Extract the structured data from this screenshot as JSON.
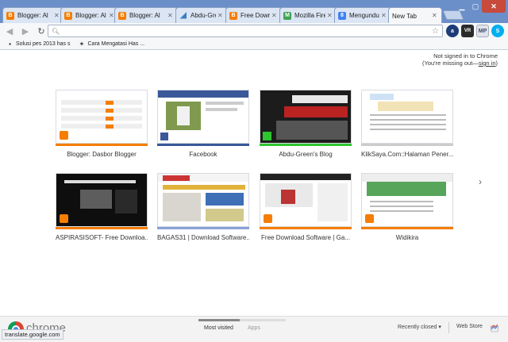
{
  "tabs": [
    {
      "title": "Blogger: Al",
      "icon": "blogger-icon",
      "active": false
    },
    {
      "title": "Blogger: Al",
      "icon": "blogger-icon",
      "active": false
    },
    {
      "title": "Blogger: Al",
      "icon": "blogger-icon",
      "active": false
    },
    {
      "title": "Abdu-Green",
      "icon": "abdu-green-icon",
      "active": false
    },
    {
      "title": "Free Downl",
      "icon": "blogger-icon",
      "active": false
    },
    {
      "title": "Mozilla Fire",
      "icon": "mozilla-icon",
      "active": false
    },
    {
      "title": "Mengunduh",
      "icon": "google-icon",
      "active": false
    },
    {
      "title": "New Tab",
      "icon": "",
      "active": true
    }
  ],
  "toolbar": {
    "back_icon": "back-arrow-icon",
    "forward_icon": "forward-arrow-icon",
    "reload_icon": "reload-icon",
    "omnibox_value": "",
    "extensions": [
      {
        "name": "a-extension-icon",
        "glyph": "a"
      },
      {
        "name": "vr-extension-icon",
        "glyph": "VR"
      },
      {
        "name": "mp-extension-icon",
        "glyph": "MP"
      },
      {
        "name": "skype-icon",
        "glyph": "S"
      },
      {
        "name": "menu-icon",
        "glyph": "≡"
      }
    ]
  },
  "bookmarks": [
    {
      "label": "Solusi pes 2013 has s",
      "icon": "pes-icon"
    },
    {
      "label": "Cara Mengatasi Has ...",
      "icon": "bug-icon"
    }
  ],
  "signin": {
    "line1": "Not signed in to Chrome",
    "line2_prefix": "(You're missing out—",
    "line2_link": "sign in",
    "line2_suffix": ")"
  },
  "most_visited": [
    {
      "label": "Blogger: Dasbor Blogger",
      "bar_color": "#f57d00",
      "kind": "blogger"
    },
    {
      "label": "Facebook",
      "bar_color": "#3b5998",
      "kind": "facebook"
    },
    {
      "label": "Abdu-Green's Blog",
      "bar_color": "#2fc52f",
      "kind": "dark"
    },
    {
      "label": "KlikSaya.Com::Halaman Pener...",
      "bar_color": "#cccccc",
      "kind": "light"
    },
    {
      "label": "ASPIRASISOFT- Free Downloa...",
      "bar_color": "#f57d00",
      "kind": "black"
    },
    {
      "label": "BAGAS31 | Download Software...",
      "bar_color": "#8aa0d8",
      "kind": "bagas"
    },
    {
      "label": "Free Download Software | Ga...",
      "bar_color": "#f57d00",
      "kind": "freedl"
    },
    {
      "label": "Widikira",
      "bar_color": "#f57d00",
      "kind": "widikira"
    }
  ],
  "bottom": {
    "brand": "chrome",
    "status_url": "translate.google.com",
    "most_visited": "Most visited",
    "apps": "Apps",
    "recently_closed": "Recently closed",
    "web_store": "Web Store"
  }
}
